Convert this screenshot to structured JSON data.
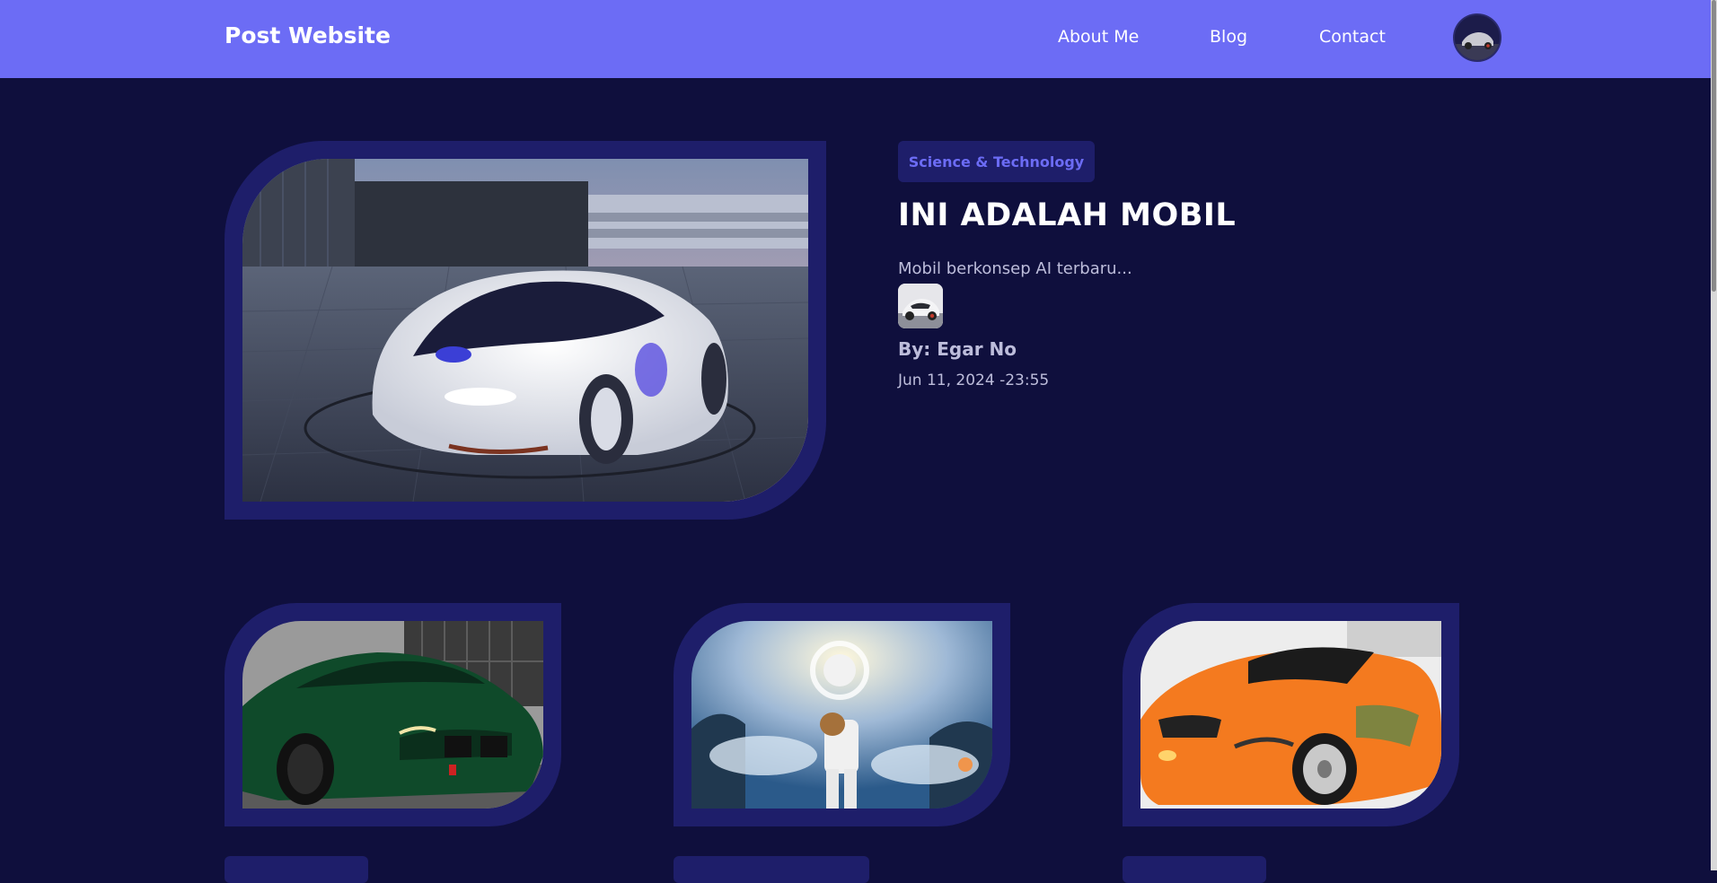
{
  "navbar": {
    "brand": "Post Website",
    "links": [
      "About Me",
      "Blog",
      "Contact"
    ],
    "color": "#6c6cf5"
  },
  "featured_post": {
    "category": "Science & Technology",
    "title": "INI ADALAH MOBIL",
    "excerpt": "Mobil berkonsep AI terbaru...",
    "author": "By: Egar No",
    "date": "Jun 11, 2024 -23:55"
  },
  "icons": {
    "profile": "profile-avatar-icon",
    "author": "author-avatar-icon"
  },
  "colors": {
    "background": "#0f0f3d",
    "card_frame": "#1e1e6a",
    "accent": "#6c6cf5"
  }
}
